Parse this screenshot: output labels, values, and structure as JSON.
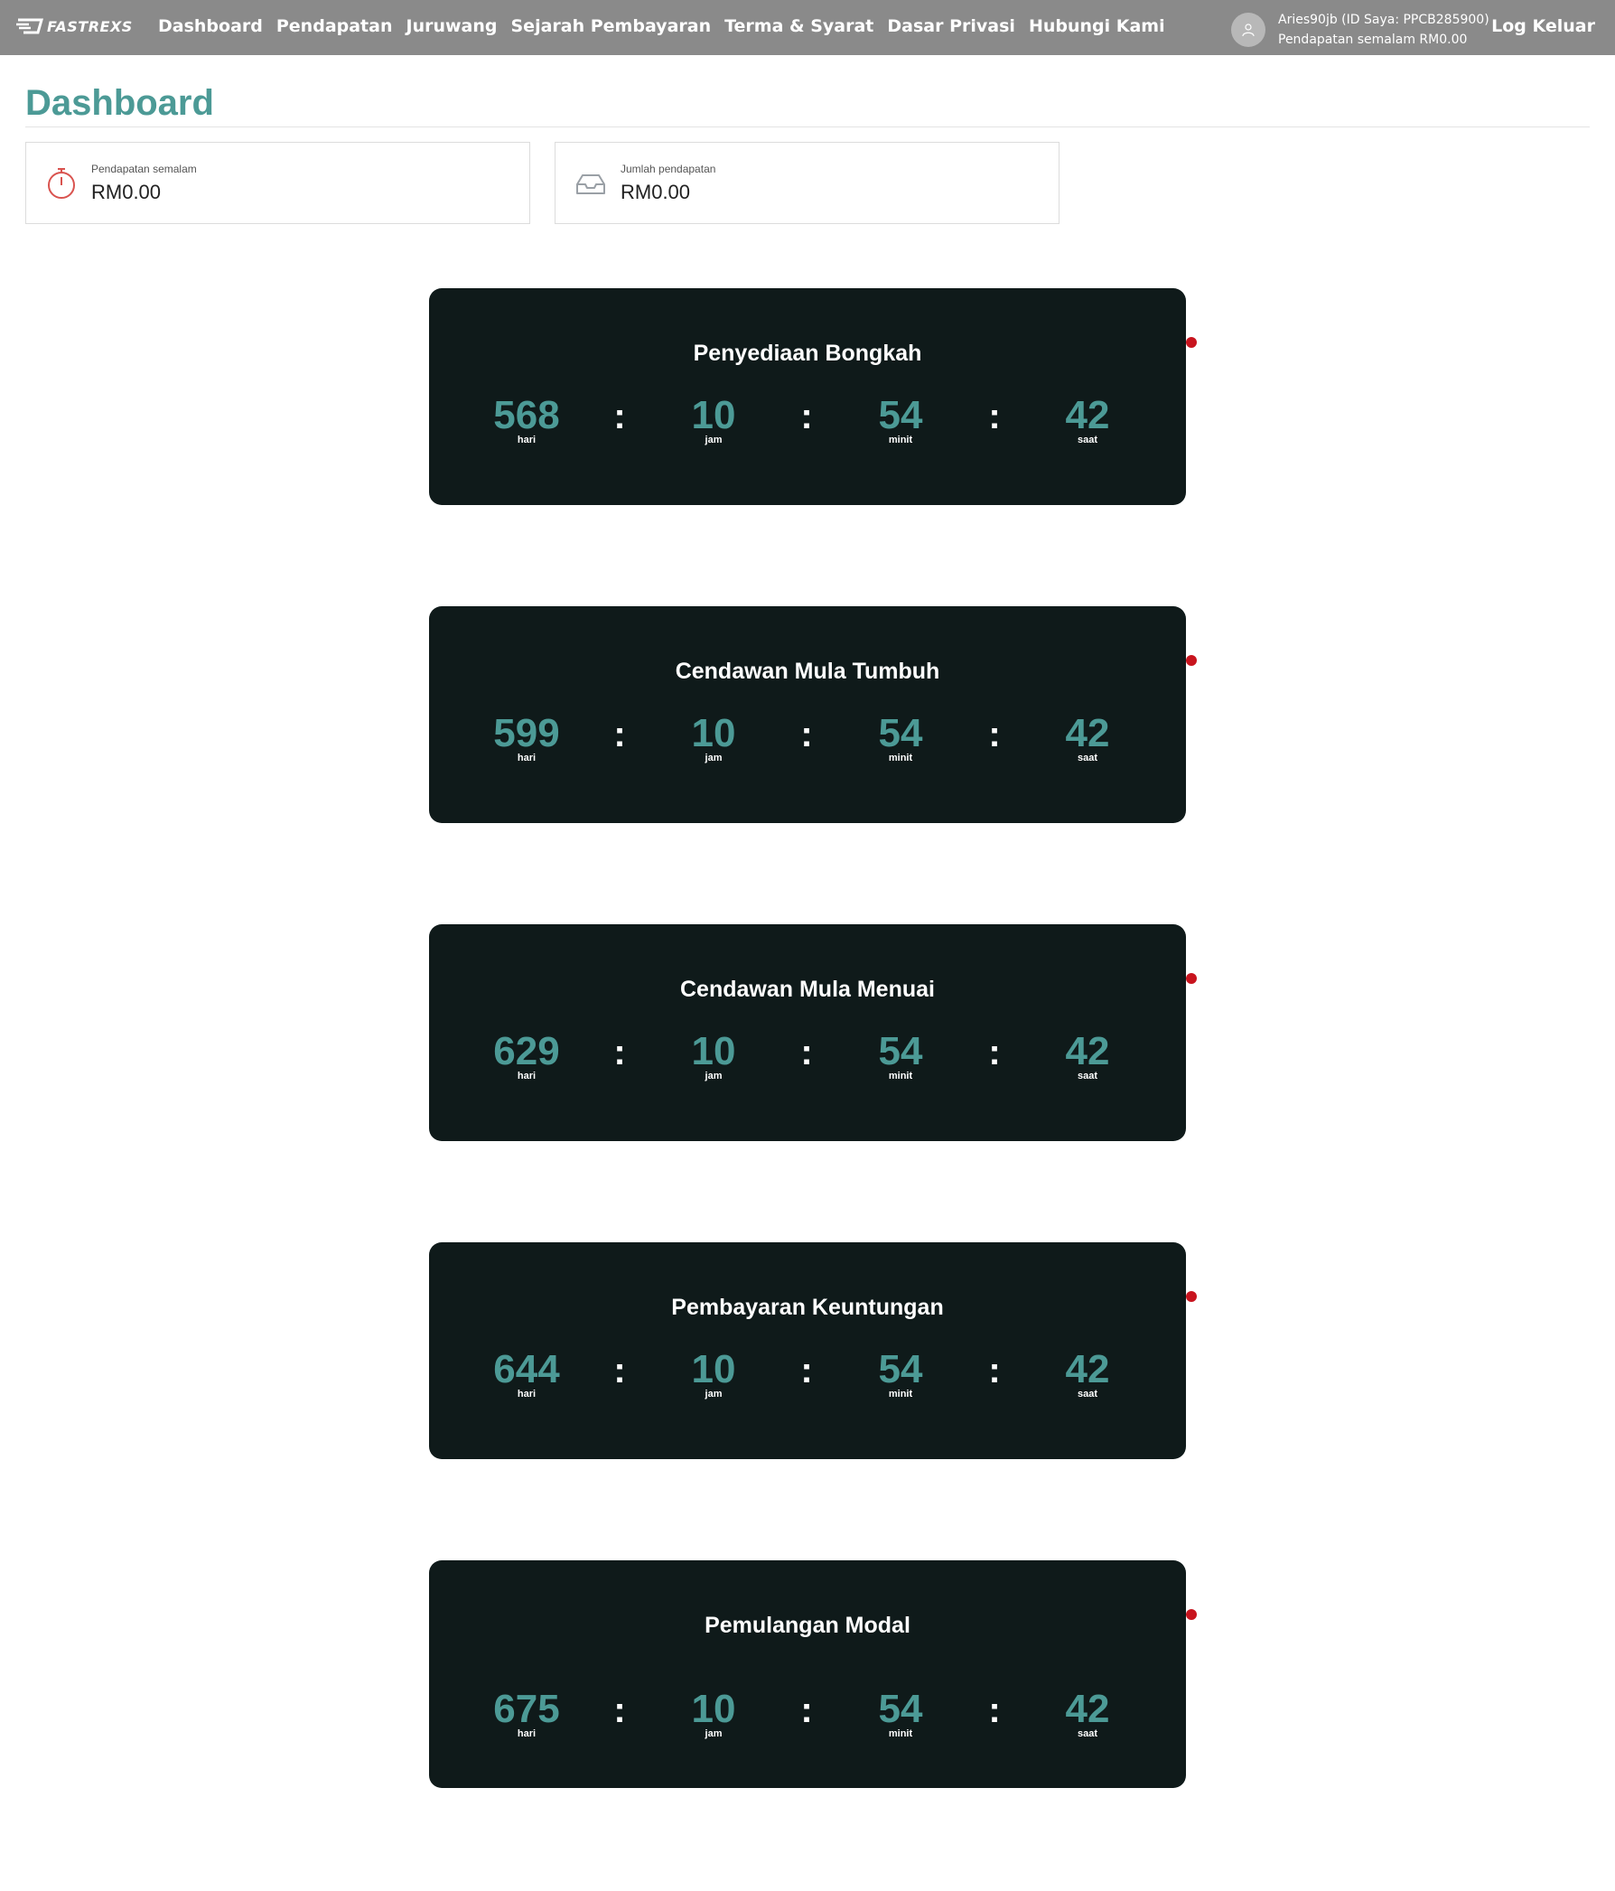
{
  "nav": {
    "logo_text": "FASTREXS",
    "items": [
      "Dashboard",
      "Pendapatan",
      "Juruwang",
      "Sejarah Pembayaran",
      "Terma & Syarat",
      "Dasar Privasi",
      "Hubungi Kami"
    ],
    "user_line1": "Aries90jb  (ID Saya: PPCB285900)",
    "user_line2": "Pendapatan semalam  RM0.00",
    "logout": "Log Keluar"
  },
  "page": {
    "title": "Dashboard"
  },
  "stats": [
    {
      "label": "Pendapatan semalam",
      "value": "RM0.00",
      "icon": "stopwatch-icon",
      "color": "#d9534f"
    },
    {
      "label": "Jumlah pendapatan",
      "value": "RM0.00",
      "icon": "inbox-icon",
      "color": "#9aa0a6"
    }
  ],
  "countdowns": [
    {
      "title": "Penyediaan Bongkah",
      "days": "568",
      "hours": "10",
      "minutes": "54",
      "seconds": "42"
    },
    {
      "title": "Cendawan Mula Tumbuh",
      "days": "599",
      "hours": "10",
      "minutes": "54",
      "seconds": "42"
    },
    {
      "title": "Cendawan Mula Menuai",
      "days": "629",
      "hours": "10",
      "minutes": "54",
      "seconds": "42"
    },
    {
      "title": "Pembayaran Keuntungan",
      "days": "644",
      "hours": "10",
      "minutes": "54",
      "seconds": "42"
    },
    {
      "title": "Pemulangan Modal",
      "days": "675",
      "hours": "10",
      "minutes": "54",
      "seconds": "42"
    }
  ],
  "units": {
    "days": "hari",
    "hours": "jam",
    "minutes": "minit",
    "seconds": "saat"
  },
  "separator": ":",
  "colors": {
    "navbar": "#8a8a8a",
    "accent": "#4c9a96",
    "card": "#0f1a1a",
    "dot": "#c8141e"
  }
}
